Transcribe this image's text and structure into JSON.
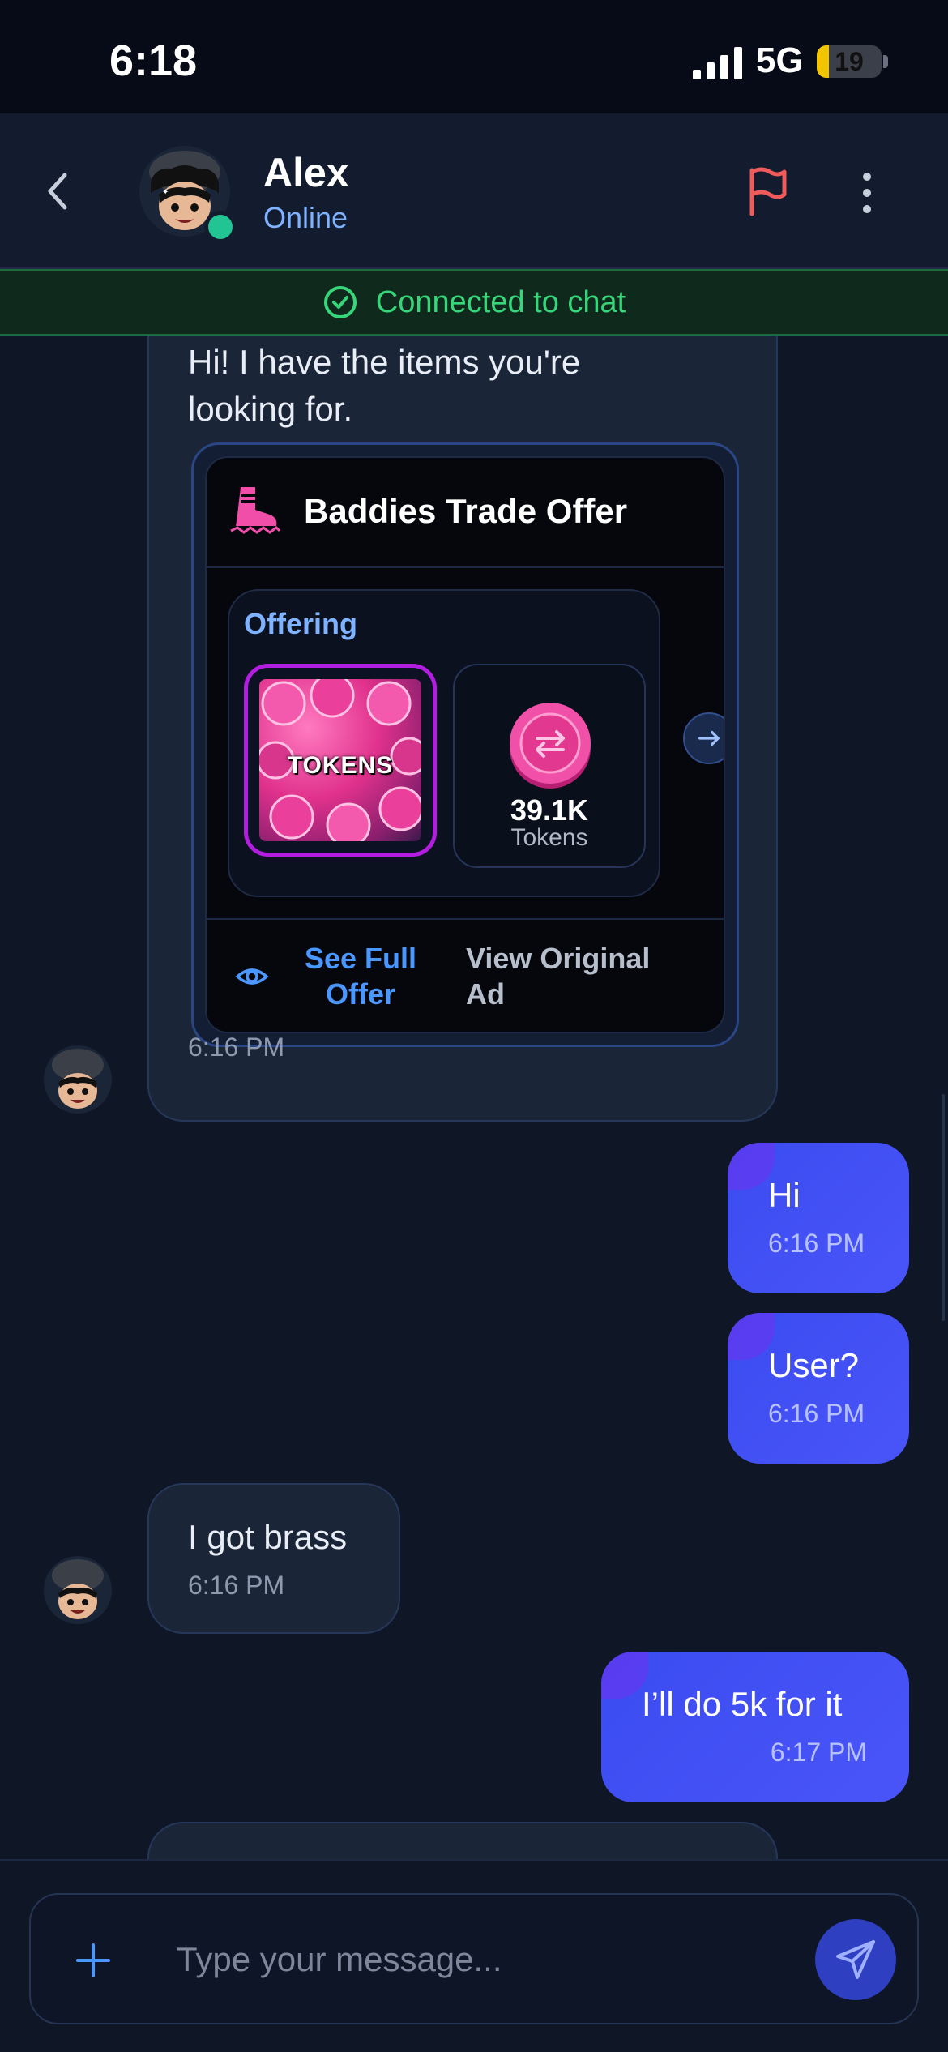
{
  "status_bar": {
    "time": "6:18",
    "network": "5G",
    "battery": "19",
    "battery_level": 0.19
  },
  "header": {
    "name": "Alex",
    "status": "Online"
  },
  "banner": {
    "text": "Connected to chat"
  },
  "messages": [
    {
      "side": "in",
      "text": "Hi! I have the items you're looking for.",
      "time": "6:16 PM",
      "offer": {
        "title": "Baddies Trade Offer",
        "section_label": "Offering",
        "item1_label": "TOKENS",
        "item2_amount": "39.1K",
        "item2_unit": "Tokens",
        "see_full": "See Full Offer",
        "view_original": "View Original Ad"
      }
    },
    {
      "side": "out",
      "text": "Hi",
      "time": "6:16 PM"
    },
    {
      "side": "out",
      "text": "User?",
      "time": "6:16 PM"
    },
    {
      "side": "in",
      "text": "I got brass",
      "time": "6:16 PM"
    },
    {
      "side": "out",
      "text": "I’ll do 5k for it",
      "time": "6:17 PM"
    }
  ],
  "composer": {
    "placeholder": "Type your message..."
  },
  "colors": {
    "background": "#0f1626",
    "outgoing_bubble": "#4250f5",
    "incoming_bubble": "#1b2538",
    "online": "#22c493",
    "connected_green": "#37d67a",
    "flag_red": "#f05a5a",
    "link_blue": "#4a97ff"
  },
  "icons": [
    "back-icon",
    "flag-icon",
    "more-icon",
    "check-circle-icon",
    "boot-icon",
    "coin-icon",
    "arrow-right-icon",
    "eye-icon",
    "plus-icon",
    "send-icon"
  ]
}
